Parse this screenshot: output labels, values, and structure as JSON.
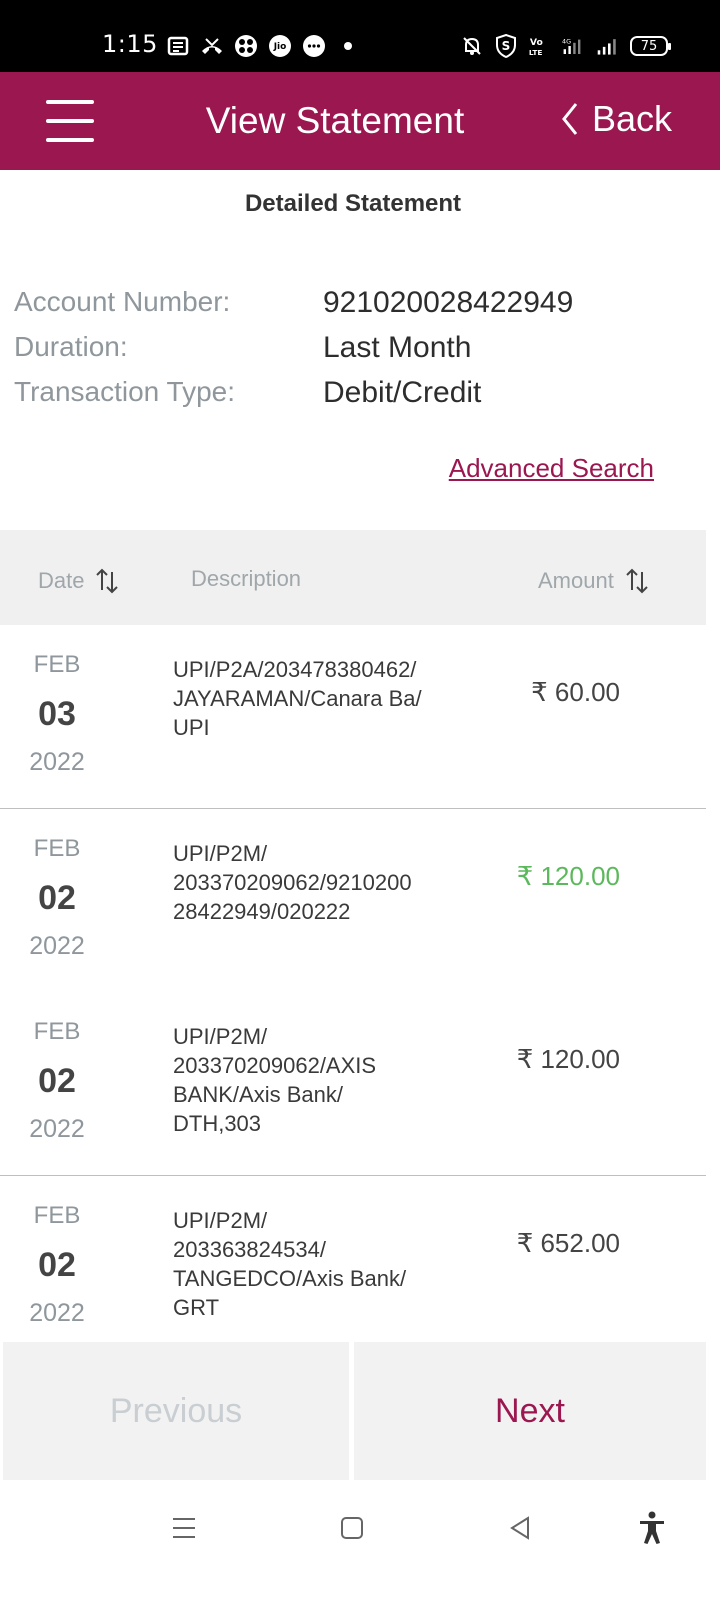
{
  "status_bar": {
    "time": "1:15",
    "battery": "75",
    "icons_left": [
      "news-icon",
      "missed-call-icon",
      "clover-icon",
      "jio-icon",
      "chat-bubble-icon",
      "dot-icon"
    ],
    "icons_right": [
      "mute-bell-icon",
      "shield-s-icon",
      "volte-icon",
      "signal-4g-icon",
      "signal-icon",
      "battery-icon"
    ]
  },
  "header": {
    "title": "View Statement",
    "back_label": "Back",
    "color": "#9b1750"
  },
  "subtitle": "Detailed Statement",
  "account": {
    "number_label": "Account Number:",
    "number_value": "921020028422949",
    "duration_label": "Duration:",
    "duration_value": "Last Month",
    "type_label": "Transaction Type:",
    "type_value": "Debit/Credit"
  },
  "advanced_search": "Advanced Search",
  "table": {
    "headers": {
      "date": "Date",
      "description": "Description",
      "amount": "Amount"
    },
    "rows": [
      {
        "month": "FEB",
        "day": "03",
        "year": "2022",
        "description": "UPI/P2A/203478380462/\nJAYARAMAN/Canara Ba/\nUPI",
        "amount": "₹ 60.00",
        "type": "debit"
      },
      {
        "month": "FEB",
        "day": "02",
        "year": "2022",
        "description": "UPI/P2M/\n203370209062/9210200\n28422949/020222",
        "amount": "₹ 120.00",
        "type": "credit"
      },
      {
        "month": "FEB",
        "day": "02",
        "year": "2022",
        "description": "UPI/P2M/\n203370209062/AXIS\nBANK/Axis Bank/\nDTH,303",
        "amount": "₹ 120.00",
        "type": "debit"
      },
      {
        "month": "FEB",
        "day": "02",
        "year": "2022",
        "description": "UPI/P2M/\n203363824534/\nTANGEDCO/Axis Bank/\nGRT",
        "amount": "₹ 652.00",
        "type": "debit"
      }
    ]
  },
  "pager": {
    "previous": "Previous",
    "next": "Next"
  },
  "colors": {
    "brand": "#9b1750",
    "credit": "#5cb85c",
    "muted": "#8f979c"
  }
}
